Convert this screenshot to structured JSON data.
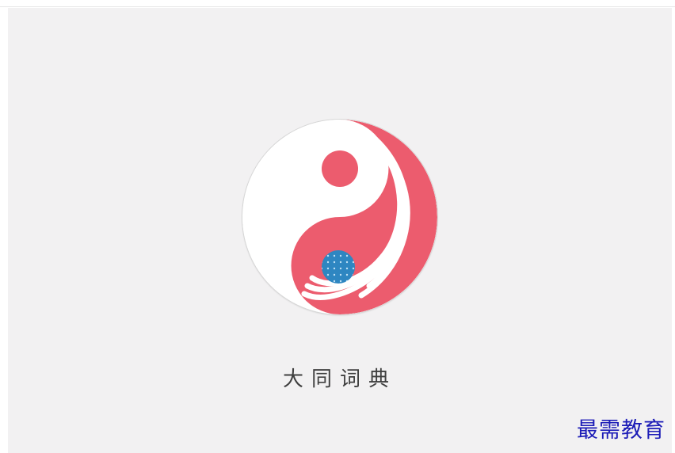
{
  "app": {
    "name": "大同词典"
  },
  "logo": {
    "icon": "yin-yang-logo-icon",
    "colors": {
      "primary": "#ec5c6e",
      "secondary": "#2e86c1",
      "background": "#ffffff"
    }
  },
  "watermark": {
    "text": "最需教育"
  },
  "colors": {
    "stage_background": "#f2f1f2",
    "title_text": "#3f3f3f",
    "watermark_text": "#1c1cb7"
  }
}
